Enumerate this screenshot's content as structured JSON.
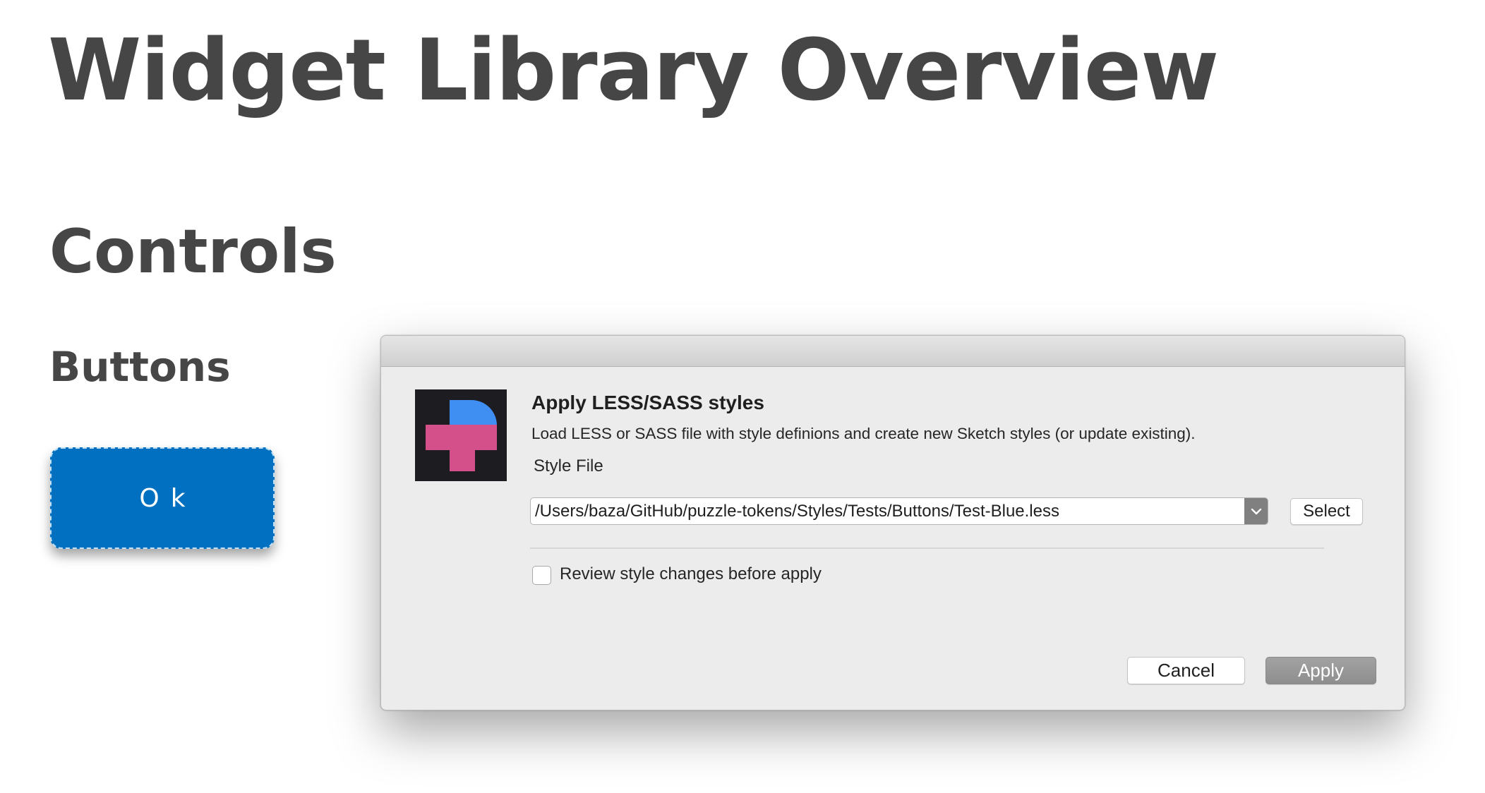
{
  "page": {
    "title": "Widget Library Overview",
    "section": "Controls",
    "subsection": "Buttons",
    "sample_button_label": "Ok",
    "sample_button_color": "#0170c0"
  },
  "dialog": {
    "icon": "puzzle-tokens-app-icon",
    "title": "Apply LESS/SASS styles",
    "description": "Load LESS or SASS file with style definions and create new Sketch styles (or update existing).",
    "style_file_label": "Style File",
    "style_file_value": "/Users/baza/GitHub/puzzle-tokens/Styles/Tests/Buttons/Test-Blue.less",
    "select_label": "Select",
    "review_checkbox_label": "Review style changes before apply",
    "review_checked": false,
    "cancel_label": "Cancel",
    "apply_label": "Apply"
  },
  "icons": [
    "puzzle-tokens-app-icon",
    "chevron-down-icon"
  ]
}
